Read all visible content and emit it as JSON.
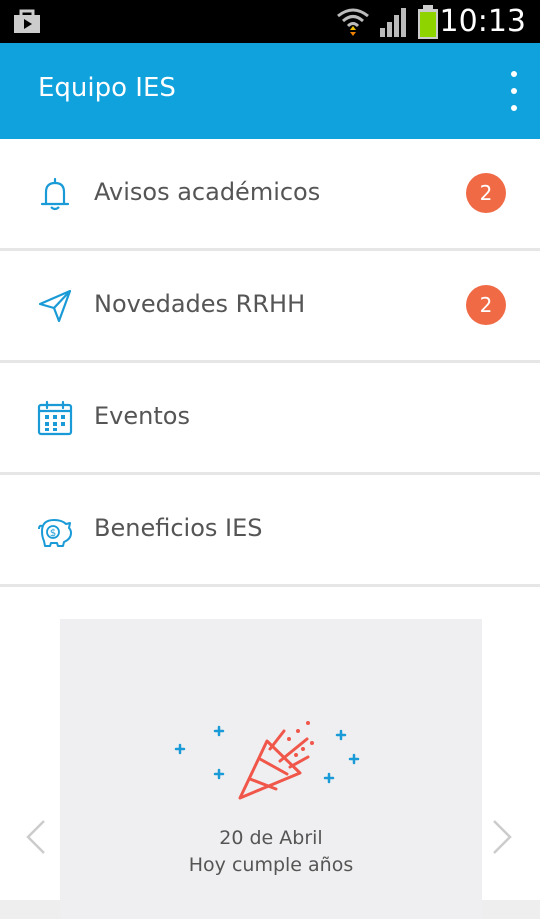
{
  "status_bar": {
    "time": "10:13",
    "icons": [
      "store-icon",
      "wifi-icon",
      "signal-icon",
      "battery-icon"
    ]
  },
  "app_bar": {
    "title": "Equipo IES",
    "menu_icon": "overflow-menu-icon",
    "color": "#0fa2dc"
  },
  "menu": {
    "items": [
      {
        "label": "Avisos académicos",
        "icon": "bell-icon",
        "badge": "2"
      },
      {
        "label": "Novedades RRHH",
        "icon": "paper-plane-icon",
        "badge": "2"
      },
      {
        "label": "Eventos",
        "icon": "calendar-icon",
        "badge": ""
      },
      {
        "label": "Beneficios IES",
        "icon": "piggy-bank-icon",
        "badge": ""
      }
    ],
    "icon_color": "#1a9bd7",
    "badge_color": "#f06a46"
  },
  "birthday_card": {
    "date": "20 de Abril",
    "caption": "Hoy cumple años",
    "icon": "party-popper-icon",
    "prev_icon": "chevron-left-icon",
    "next_icon": "chevron-right-icon"
  }
}
